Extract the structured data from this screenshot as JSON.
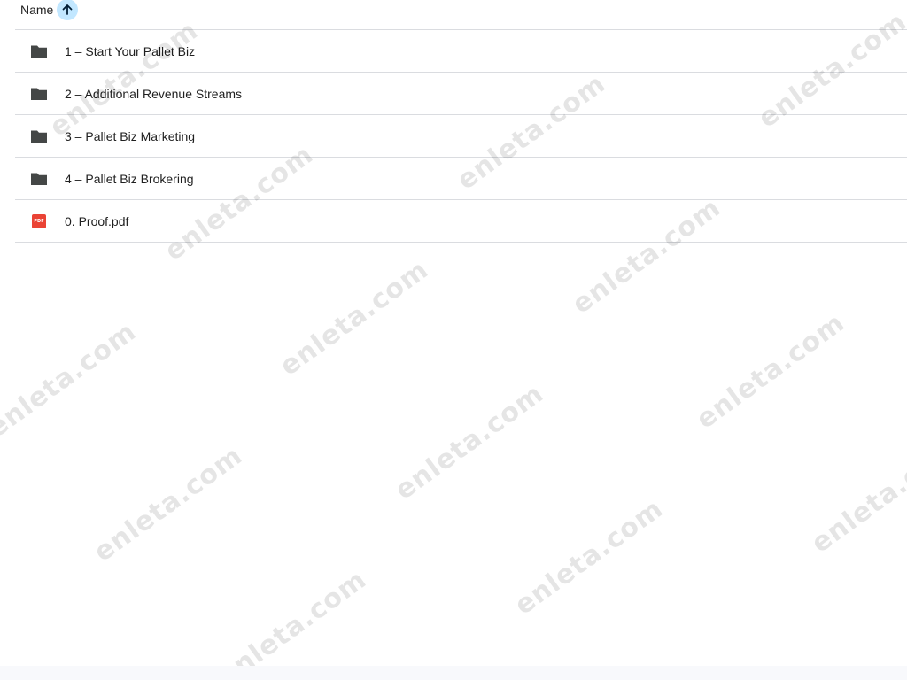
{
  "header": {
    "name_label": "Name",
    "sort_icon": "arrow-up-icon"
  },
  "files": [
    {
      "label": "1 – Start Your Pallet Biz",
      "icon": "folder-icon"
    },
    {
      "label": "2 – Additional Revenue Streams",
      "icon": "folder-icon"
    },
    {
      "label": "3 – Pallet Biz Marketing",
      "icon": "folder-icon"
    },
    {
      "label": "4 – Pallet Biz Brokering",
      "icon": "folder-icon"
    },
    {
      "label": "0. Proof.pdf",
      "icon": "pdf-icon",
      "badge": "PDF"
    }
  ],
  "watermark": {
    "text": "enleta.com"
  },
  "colors": {
    "folder": "#444746",
    "pdf": "#ea4335",
    "sort_accent": "#c2e7ff",
    "divider": "#dadce0"
  }
}
